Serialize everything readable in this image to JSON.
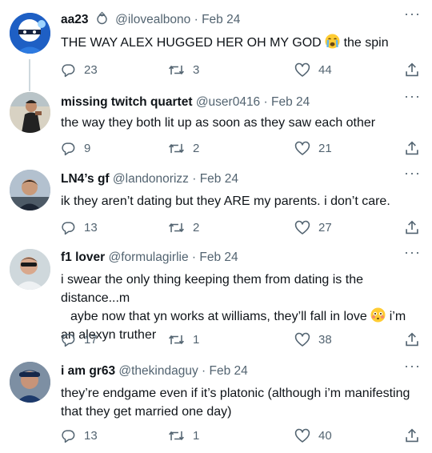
{
  "tweets": [
    {
      "name": "aa23",
      "has_badge": true,
      "handle": "@ilovealbono",
      "date": "Feb 24",
      "text_before": "THE WAY ALEX HUGGED HER OH MY GOD ",
      "emoji": "crying-face",
      "text_after": " the spin",
      "replies": "23",
      "retweets": "3",
      "likes": "44"
    },
    {
      "name": "missing twitch quartet",
      "handle": "@user0416",
      "date": "Feb 24",
      "text": "the way they both lit up as soon as they saw each other",
      "replies": "9",
      "retweets": "2",
      "likes": "21"
    },
    {
      "name": "LN4’s gf",
      "handle": "@landonorizz",
      "date": "Feb 24",
      "text": "ik they aren’t dating but they ARE my parents. i don’t care.",
      "replies": "13",
      "retweets": "2",
      "likes": "27"
    },
    {
      "name": "f1 lover",
      "handle": "@formulagirlie",
      "date": "Feb 24",
      "line1": "i swear the only thing keeping them from dating is the distance...m",
      "line2": "aybe now that yn works at williams, they’ll fall in love ",
      "emoji": "flushed-face",
      "line2_after": "  i’m",
      "line3": "an alexyn truther",
      "replies": "17",
      "retweets": "1",
      "likes": "38"
    },
    {
      "name": "i am gr63",
      "handle": "@thekindaguy",
      "date": "Feb 24",
      "line1": "they’re endgame even if it’s platonic (although i’m manifesting",
      "line2": "that they get married one day)",
      "replies": "13",
      "retweets": "1",
      "likes": "40"
    }
  ],
  "separator": "·",
  "more_label": "···",
  "colors": {
    "text": "#0f1419",
    "secondary": "#536471",
    "thread_line": "#cfd9de",
    "emoji_yellow": "#ffcc33"
  }
}
